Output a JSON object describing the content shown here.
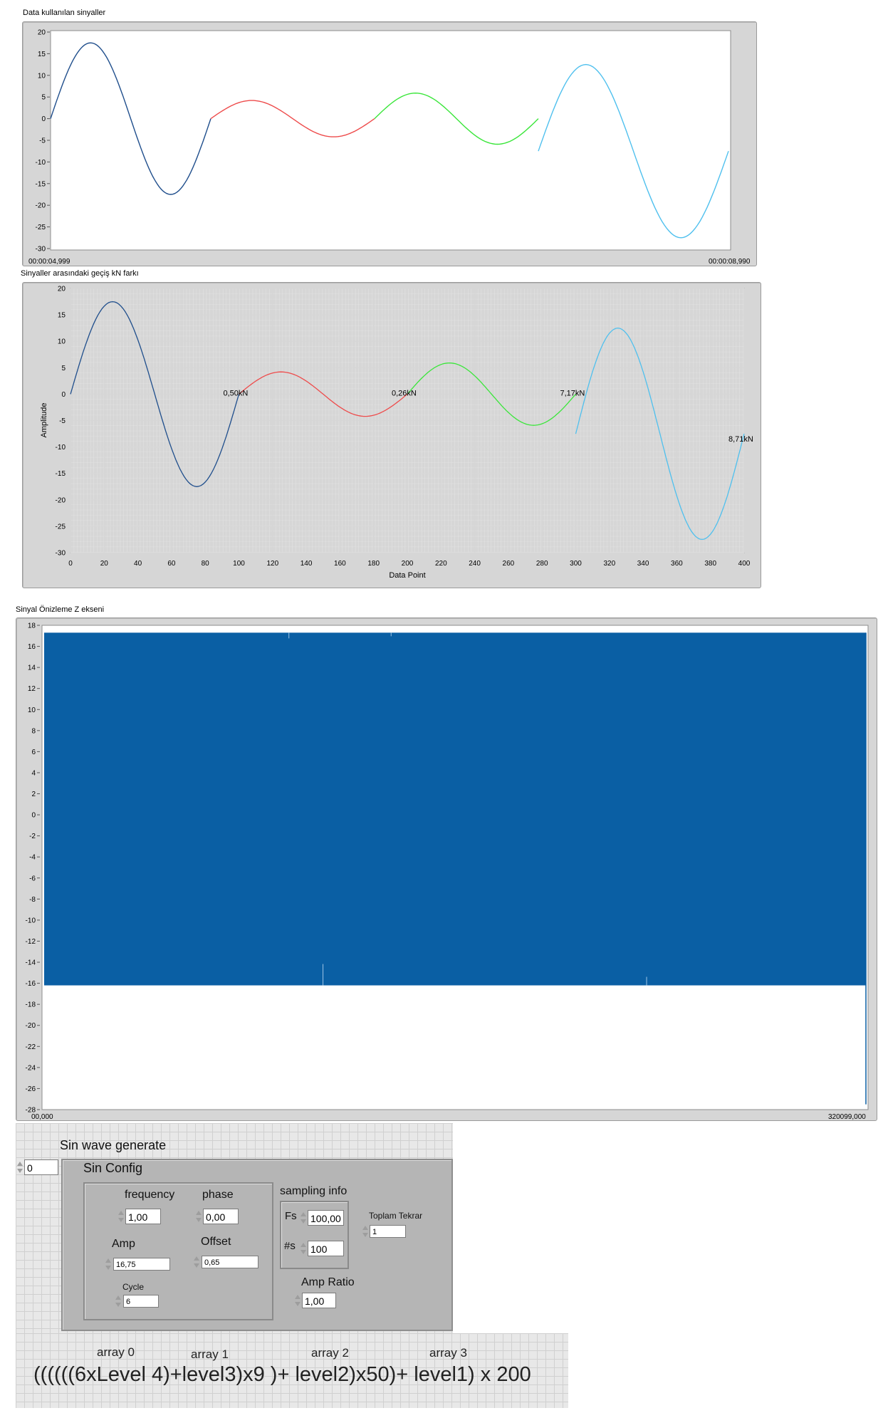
{
  "graphs": {
    "top": {
      "caption": "Data kullanılan sinyaller",
      "y_ticks": [
        "20",
        "15",
        "10",
        "5",
        "0",
        "-5",
        "-10",
        "-15",
        "-20",
        "-25",
        "-30"
      ],
      "x_start": "00:00:04,999",
      "x_end": "00:00:08,990"
    },
    "middle": {
      "caption": "Sinyaller arasındaki geçiş kN farkı",
      "y_ticks": [
        "20",
        "15",
        "10",
        "5",
        "0",
        "-5",
        "-10",
        "-15",
        "-20",
        "-25",
        "-30"
      ],
      "x_ticks": [
        "0",
        "20",
        "40",
        "60",
        "80",
        "100",
        "120",
        "140",
        "160",
        "180",
        "200",
        "220",
        "240",
        "260",
        "280",
        "300",
        "320",
        "340",
        "360",
        "380",
        "400"
      ],
      "ylabel": "Amplitude",
      "xlabel": "Data Point",
      "annotations": [
        "0,50kN",
        "0,26kN",
        "7,17kN",
        "8,71kN"
      ]
    },
    "bottom": {
      "caption": "Sinyal Önizleme Z ekseni",
      "y_ticks": [
        "18",
        "16",
        "14",
        "12",
        "10",
        "8",
        "6",
        "4",
        "2",
        "0",
        "-2",
        "-4",
        "-6",
        "-8",
        "-10",
        "-12",
        "-14",
        "-16",
        "-18",
        "-20",
        "-22",
        "-24",
        "-26",
        "-28"
      ],
      "x_start": "00,000",
      "x_end": "320099,000"
    }
  },
  "chart_data": [
    {
      "type": "line",
      "title": "Data kullanılan sinyaller",
      "ylim": [
        -30,
        20
      ],
      "x_range": [
        "00:00:04,999",
        "00:00:08,990"
      ],
      "series": [
        {
          "color": "#1f4e8c",
          "amplitude": 17.5,
          "offset": 0.0,
          "cycles": 1
        },
        {
          "color": "#ee4b4b",
          "amplitude": 4.2,
          "offset": 0.0,
          "cycles": 1
        },
        {
          "color": "#3ae63a",
          "amplitude": 5.9,
          "offset": 0.0,
          "cycles": 1
        },
        {
          "color": "#4fc0ee",
          "amplitude": 20.0,
          "offset": -7.5,
          "cycles": 1
        }
      ]
    },
    {
      "type": "line",
      "title": "Sinyaller arasındaki geçiş kN farkı",
      "xlabel": "Data Point",
      "ylabel": "Amplitude",
      "xlim": [
        0,
        400
      ],
      "ylim": [
        -30,
        20
      ],
      "series": [
        {
          "color": "#1f4e8c",
          "x_start": 0,
          "x_end": 100,
          "amplitude": 17.5,
          "offset": 0.0
        },
        {
          "color": "#ee4b4b",
          "x_start": 100,
          "x_end": 200,
          "amplitude": 4.2,
          "offset": 0.0
        },
        {
          "color": "#3ae63a",
          "x_start": 200,
          "x_end": 300,
          "amplitude": 5.9,
          "offset": 0.0
        },
        {
          "color": "#4fc0ee",
          "x_start": 300,
          "x_end": 400,
          "amplitude": 20.0,
          "offset": -7.5
        }
      ],
      "annotations": [
        {
          "x": 100,
          "y": 0,
          "text": "0,50kN"
        },
        {
          "x": 200,
          "y": 0,
          "text": "0,26kN"
        },
        {
          "x": 300,
          "y": 0,
          "text": "7,17kN"
        },
        {
          "x": 400,
          "y": -8.7,
          "text": "8,71kN"
        }
      ]
    },
    {
      "type": "area",
      "title": "Sinyal Önizleme Z ekseni",
      "ylim": [
        -28,
        18
      ],
      "x_range": [
        "00,000",
        "320099,000"
      ],
      "series": [
        {
          "color": "#0a5fa4",
          "max": 17.3,
          "min": -16.2,
          "min_at_end": -27.5
        }
      ]
    }
  ],
  "sin_wave": {
    "title": "Sin wave generate",
    "index_value": "0",
    "config_title": "Sin Config",
    "frequency": {
      "label": "frequency",
      "value": "1,00"
    },
    "phase": {
      "label": "phase",
      "value": "0,00"
    },
    "amp": {
      "label": "Amp",
      "value": "16,75"
    },
    "offset": {
      "label": "Offset",
      "value": "0,65"
    },
    "cycle": {
      "label": "Cycle",
      "value": "6"
    },
    "sampling": {
      "title": "sampling info",
      "fs_label": "Fs",
      "fs_value": "100,00",
      "ns_label": "#s",
      "ns_value": "100"
    },
    "toplam": {
      "label": "Toplam Tekrar",
      "value": "1"
    },
    "amp_ratio": {
      "label": "Amp Ratio",
      "value": "1,00"
    }
  },
  "formula": {
    "labels": [
      "array 0",
      "array 1",
      "array 2",
      "array 3"
    ],
    "text": "((((((6xLevel 4)+level3)x9 )+ level2)x50)+ level1) x 200"
  },
  "colors": {
    "navy": "#1f4e8c",
    "red": "#ee4b4b",
    "green": "#3ae63a",
    "cyan": "#4fc0ee",
    "fill": "#0a5fa4"
  }
}
